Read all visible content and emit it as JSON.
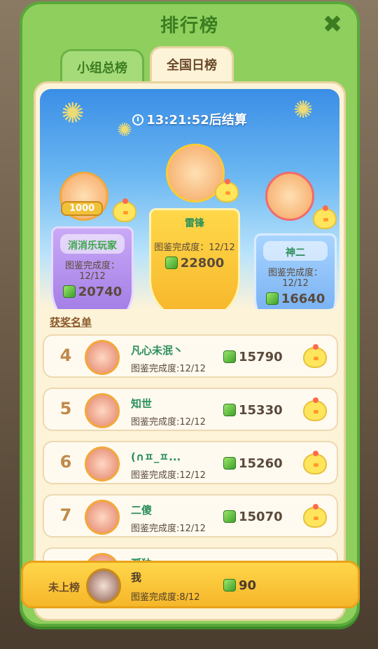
{
  "panel": {
    "title": "排行榜",
    "close_icon": "close-icon"
  },
  "tabs": [
    {
      "label": "小组总榜",
      "active": false
    },
    {
      "label": "全国日榜",
      "active": true
    }
  ],
  "timer": {
    "text": "13:21:52后结算"
  },
  "podium": {
    "first": {
      "name": "雷锋",
      "completion": "图鉴完成度：12/12",
      "score": "22800"
    },
    "second": {
      "name": "消消乐玩家",
      "completion": "图鉴完成度：12/12",
      "score": "20740",
      "badge": "1000"
    },
    "third": {
      "name": "神二",
      "completion": "图鉴完成度：12/12",
      "score": "16640"
    }
  },
  "winners_label": "获奖名单",
  "rows": [
    {
      "rank": "4",
      "name": "凡心未泯丶",
      "completion": "图鉴完成度:12/12",
      "score": "15790"
    },
    {
      "rank": "5",
      "name": "知世",
      "completion": "图鉴完成度:12/12",
      "score": "15330"
    },
    {
      "rank": "6",
      "name": "(∩ㅍ_ㅍ...",
      "completion": "图鉴完成度:12/12",
      "score": "15260"
    },
    {
      "rank": "7",
      "name": "二傻",
      "completion": "图鉴完成度:12/12",
      "score": "15070"
    },
    {
      "rank": "",
      "name": "孤独",
      "completion": "",
      "score": ""
    }
  ],
  "me": {
    "tag": "未上榜",
    "name": "我",
    "completion": "图鉴完成度:8/12",
    "score": "90"
  },
  "colors": {
    "panel_green": "#8fcf5d",
    "gold": "#f6b62a",
    "name_green": "#2b8f5a"
  }
}
